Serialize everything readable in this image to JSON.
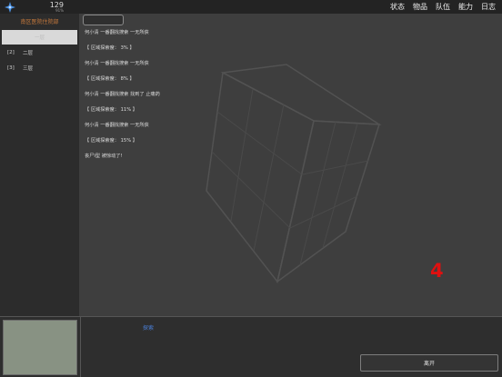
{
  "status": {
    "hp_value": "129",
    "hp_percent": "91%"
  },
  "menu": [
    "状态",
    "物品",
    "队伍",
    "能力",
    "日志"
  ],
  "location": {
    "title": "南区医院住院部",
    "floors": [
      {
        "index": "",
        "label": "一层",
        "selected": true
      },
      {
        "index": "[2]",
        "label": "二层",
        "selected": false
      },
      {
        "index": "[3]",
        "label": "三层",
        "selected": false
      }
    ]
  },
  "log": [
    "何小清 一番翻找搜索 一无所获",
    "【 区域探索度： 3% 】",
    "何小清 一番翻找搜索 一无所获",
    "【 区域探索度： 8% 】",
    "何小清 一番翻找搜索 找到了 止痛药",
    "【 区域探索度： 11% 】",
    "何小清 一番翻找搜索 一无所获",
    "【 区域探索度： 15% 】",
    "丧尸I型 被惊动了!"
  ],
  "overlay_number": "4",
  "actions": {
    "explore": "探索",
    "leave": "离开"
  },
  "colors": {
    "location_title": "#c87a3c",
    "explore_link": "#4a7fd8",
    "overlay_number": "#e01010"
  }
}
